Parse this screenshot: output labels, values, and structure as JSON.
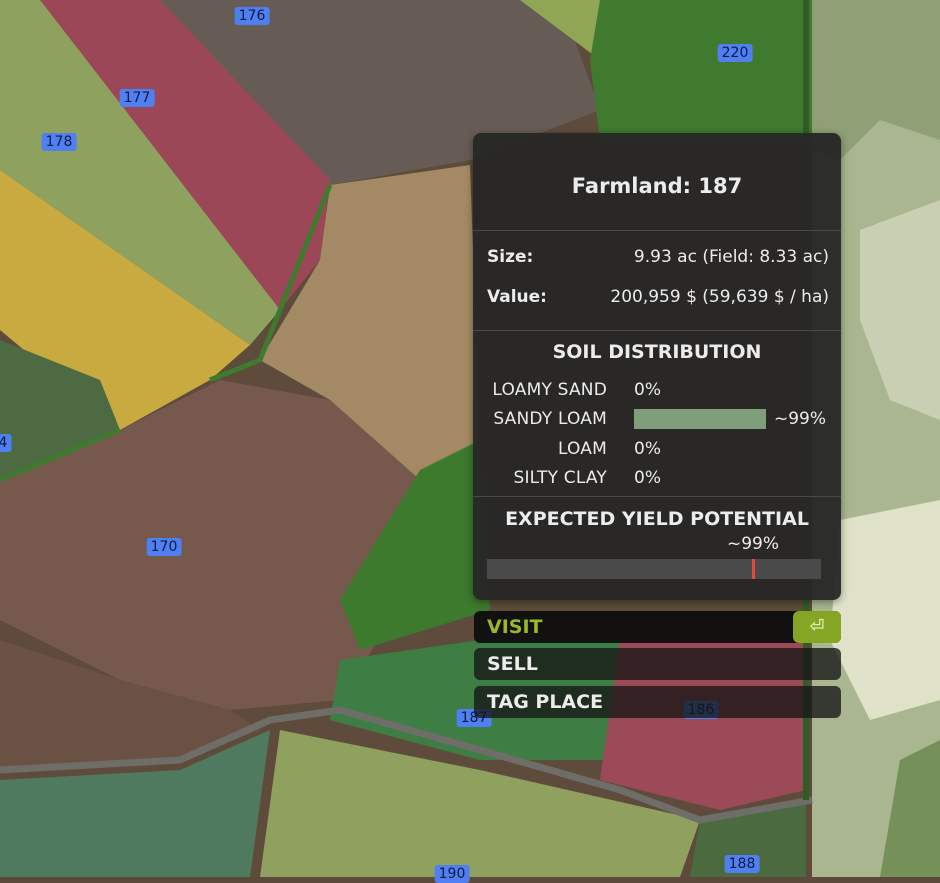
{
  "map": {
    "field_labels": [
      "176",
      "220",
      "177",
      "178",
      "4",
      "170",
      "187",
      "186",
      "188",
      "190"
    ]
  },
  "panel": {
    "title": "Farmland: 187",
    "size_label": "Size:",
    "size_value": "9.93 ac (Field: 8.33 ac)",
    "value_label": "Value:",
    "value_value": "200,959 $ (59,639 $ / ha)",
    "soil_title": "SOIL DISTRIBUTION",
    "soils": [
      {
        "name": "LOAMY SAND",
        "value": "0%",
        "fraction": 0
      },
      {
        "name": "SANDY LOAM",
        "value": "~99%",
        "fraction": 0.99
      },
      {
        "name": "LOAM",
        "value": "0%",
        "fraction": 0
      },
      {
        "name": "SILTY CLAY",
        "value": "0%",
        "fraction": 0
      }
    ],
    "yield_title": "EXPECTED YIELD POTENTIAL",
    "yield_value": "~99%",
    "yield_fraction": 0.795
  },
  "actions": {
    "visit": "VISIT",
    "enter_key": "⏎",
    "sell": "SELL",
    "tag": "TAG PLACE"
  },
  "colors": {
    "accent": "#9ab82a",
    "bar_soil": "#7f9e7a",
    "yield_marker": "#e24a3c",
    "label_bg": "#4f7ff0"
  },
  "icons": {
    "enter": "enter-key-icon"
  }
}
